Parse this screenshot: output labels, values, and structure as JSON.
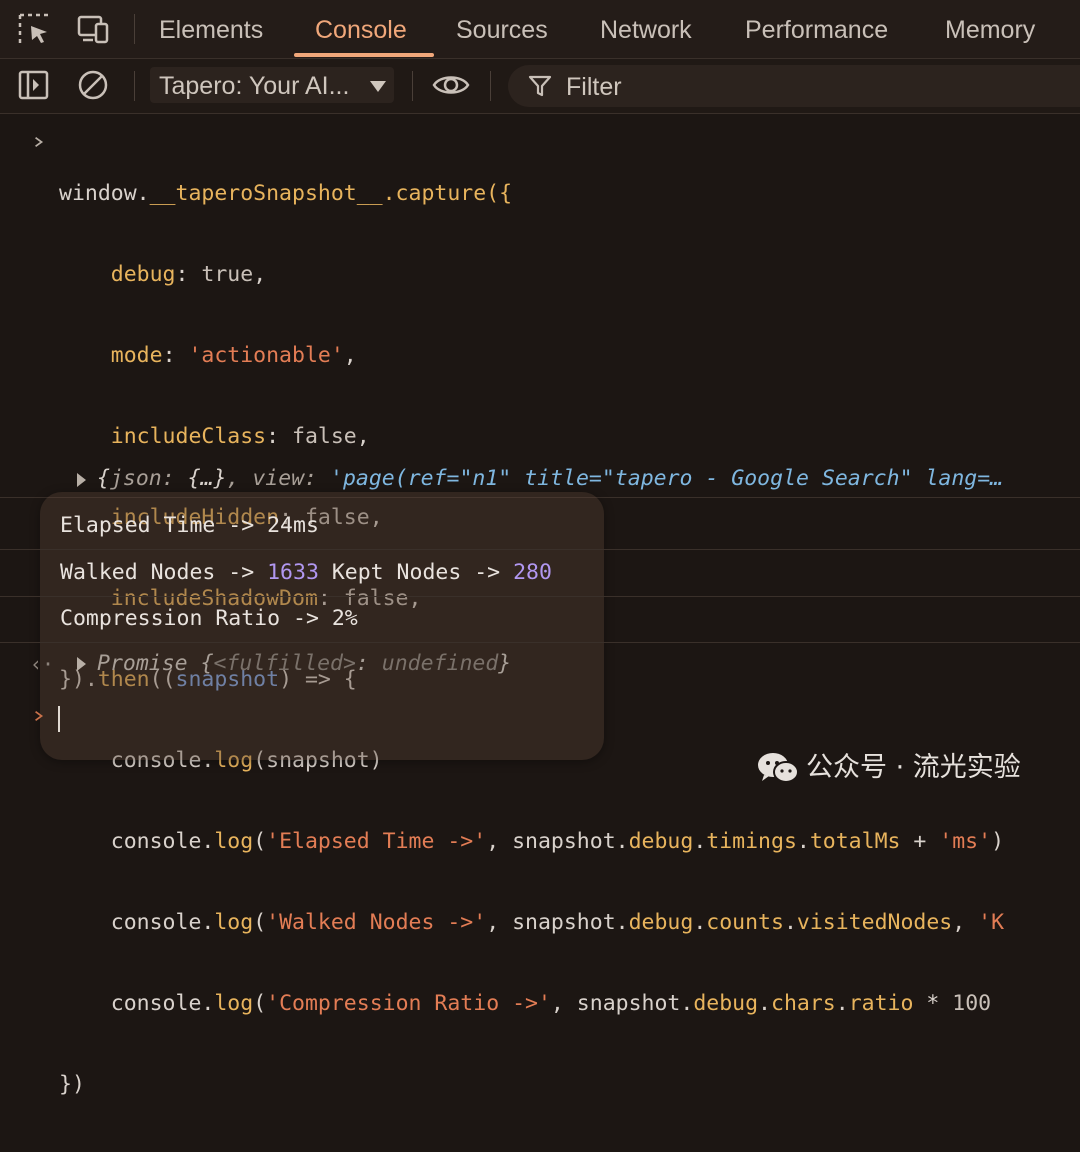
{
  "tabs": [
    {
      "label": "Elements",
      "active": false
    },
    {
      "label": "Console",
      "active": true
    },
    {
      "label": "Sources",
      "active": false
    },
    {
      "label": "Network",
      "active": false
    },
    {
      "label": "Performance",
      "active": false
    },
    {
      "label": "Memory",
      "active": false
    }
  ],
  "toolbar": {
    "context_selected": "Tapero: Your AI...",
    "filter_placeholder": "Filter"
  },
  "icons": {
    "inspect": "inspect-element-icon",
    "device": "device-toolbar-icon",
    "sidebar": "sidebar-toggle-icon",
    "clear": "clear-console-icon",
    "eye": "live-expression-eye-icon",
    "filter": "filter-funnel-icon"
  },
  "code": {
    "l1_a": "window.",
    "l1_b": "__taperoSnapshot__",
    "l1_c": ".capture({",
    "l2_k": "debug",
    "l2_v": "true",
    "l3_k": "mode",
    "l3_v": "'actionable'",
    "l4_k": "includeClass",
    "l4_v": "false",
    "l5_k": "includeHidden",
    "l5_v": "false",
    "l6_k": "includeShadowDom",
    "l6_v": "false",
    "l7_a": "}).",
    "l7_b": "then",
    "l7_c": "((",
    "l7_d": "snapshot",
    "l7_e": ") => {",
    "l8_a": "console.",
    "l8_b": "log",
    "l8_c": "(snapshot)",
    "l9_a": "console.",
    "l9_b": "log",
    "l9_c": "(",
    "l9_s1": "'Elapsed Time ->'",
    "l9_d": ", snapshot.",
    "l9_p1": "debug",
    "l9_e": ".",
    "l9_p2": "timings",
    "l9_f": ".",
    "l9_p3": "totalMs",
    "l9_g": " + ",
    "l9_s2": "'ms'",
    "l9_h": ")",
    "l10_a": "console.",
    "l10_b": "log",
    "l10_c": "(",
    "l10_s1": "'Walked Nodes ->'",
    "l10_d": ", snapshot.",
    "l10_p1": "debug",
    "l10_e": ".",
    "l10_p2": "counts",
    "l10_f": ".",
    "l10_p3": "visitedNodes",
    "l10_g": ", ",
    "l10_s2": "'K",
    "l11_a": "console.",
    "l11_b": "log",
    "l11_c": "(",
    "l11_s1": "'Compression Ratio ->'",
    "l11_d": ", snapshot.",
    "l11_p1": "debug",
    "l11_e": ".",
    "l11_p2": "chars",
    "l11_f": ".",
    "l11_p3": "ratio",
    "l11_g": " * ",
    "l11_n": "100",
    "l12": "})"
  },
  "result": {
    "open": "{",
    "k1": "json",
    "c1": ": ",
    "v1": "{…}",
    "sep": ", ",
    "k2": "view",
    "c2": ": ",
    "v2": "'page(ref=\"n1\" title=\"tapero - Google Search\" lang=…"
  },
  "logs": {
    "elapsed": "Elapsed Time -> 24ms",
    "walked_prefix": "Walked Nodes -> ",
    "walked_value": "1633",
    "kept_prefix": " Kept Nodes -> ",
    "kept_value": "280",
    "compression": "Compression Ratio -> 2%"
  },
  "promise": {
    "label": "Promise ",
    "open": "{",
    "key": "<fulfilled>",
    "colon": ": ",
    "value": "undefined",
    "close": "}"
  },
  "watermark": {
    "text": "公众号 · 流光实验"
  }
}
